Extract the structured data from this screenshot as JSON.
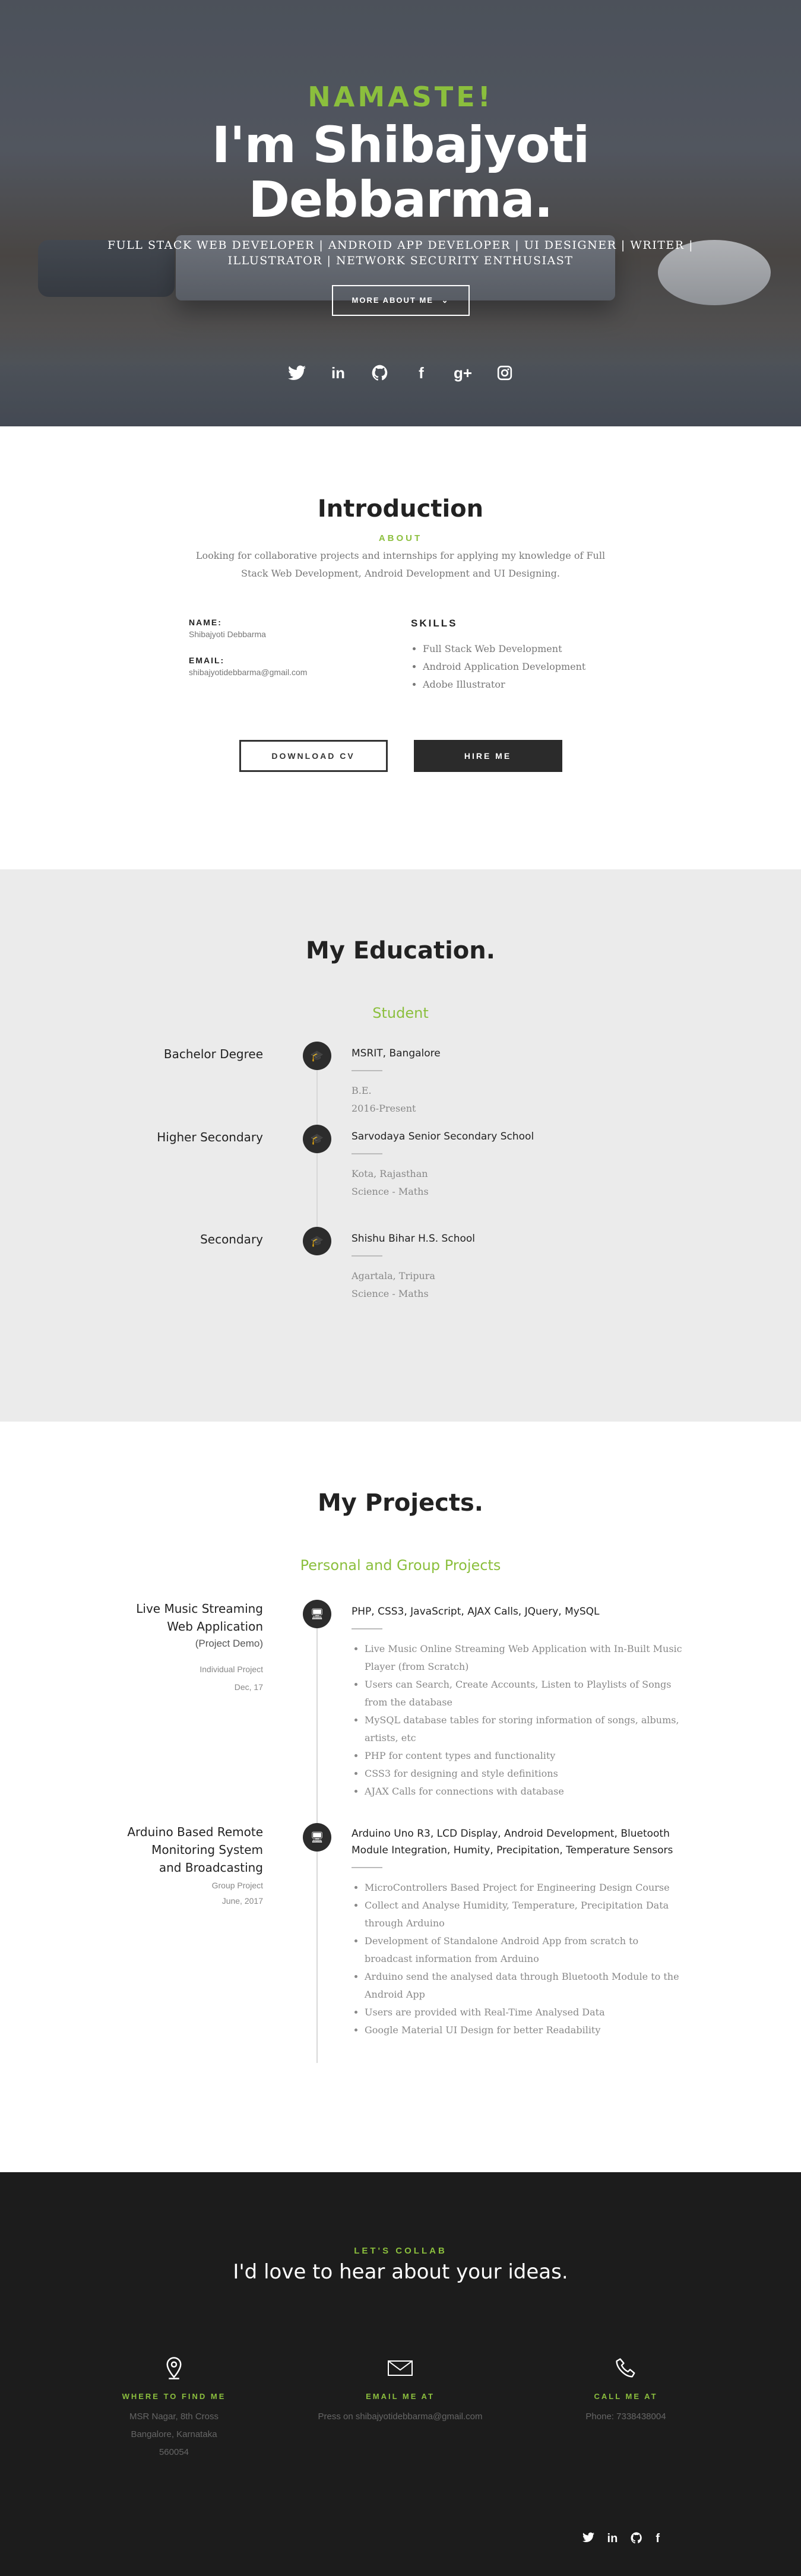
{
  "hero": {
    "greeting": "NAMASTE!",
    "name_line1": "I'm Shibajyoti",
    "name_line2": "Debbarma.",
    "tagline": "FULL STACK WEB DEVELOPER | ANDROID APP DEVELOPER | UI DESIGNER | WRITER | ILLUSTRATOR | NETWORK SECURITY ENTHUSIAST",
    "more_button": "MORE ABOUT ME",
    "social": [
      "twitter-icon",
      "linkedin-icon",
      "github-icon",
      "facebook-icon",
      "google-plus-icon",
      "instagram-icon"
    ]
  },
  "intro": {
    "title": "Introduction",
    "subtitle": "ABOUT",
    "text": "Looking for collaborative projects and internships for applying my knowledge of Full Stack Web Development, Android Development and UI Designing.",
    "name_label": "NAME:",
    "name_value": "Shibajyoti Debbarma",
    "email_label": "EMAIL:",
    "email_value": "shibajyotidebbarma@gmail.com",
    "skills_title": "SKILLS",
    "skills": [
      "Full Stack Web Development",
      "Android Application Development",
      "Adobe Illustrator"
    ],
    "download_button": "DOWNLOAD CV",
    "hire_button": "HIRE ME"
  },
  "education": {
    "title": "My Education.",
    "subtitle": "Student",
    "items": [
      {
        "level": "Bachelor Degree",
        "school": "MSRIT, Bangalore",
        "line1": "B.E.",
        "line2": "2016-Present"
      },
      {
        "level": "Higher Secondary",
        "school": "Sarvodaya Senior Secondary School",
        "line1": "Kota, Rajasthan",
        "line2": "Science - Maths"
      },
      {
        "level": "Secondary",
        "school": "Shishu Bihar H.S. School",
        "line1": "Agartala, Tripura",
        "line2": "Science - Maths"
      }
    ]
  },
  "projects": {
    "title": "My Projects.",
    "subtitle": "Personal and Group Projects",
    "items": [
      {
        "title_line1": "Live Music Streaming",
        "title_line2": "Web Application",
        "note": "(Project Demo)",
        "type": "Individual Project",
        "date": "Dec, 17",
        "tech": "PHP, CSS3, JavaScript, AJAX Calls, JQuery, MySQL",
        "points": [
          "Live Music Online Streaming Web Application with In-Built Music Player (from Scratch)",
          "Users can Search, Create Accounts, Listen to Playlists of Songs from the database",
          "MySQL database tables for storing information of songs, albums, artists, etc",
          "PHP for content types and functionality",
          "CSS3 for designing and style definitions",
          "AJAX Calls for connections with database"
        ]
      },
      {
        "title_line1": "Arduino Based Remote",
        "title_line2": "Monitoring System",
        "title_line3": "and Broadcasting",
        "type": "Group Project",
        "date": "June, 2017",
        "tech": "Arduino Uno R3, LCD Display, Android Development, Bluetooth Module Integration, Humity, Precipitation, Temperature Sensors",
        "points": [
          "MicroControllers Based Project for Engineering Design Course",
          "Collect and Analyse Humidity, Temperature, Precipitation Data through Arduino",
          "Development of Standalone Android App from scratch to broadcast information from Arduino",
          "Arduino send the analysed data through Bluetooth Module to the Android App",
          "Users are provided with Real-Time Analysed Data",
          "Google Material UI Design for better Readability"
        ]
      }
    ]
  },
  "footer": {
    "collab_sub": "LET'S COLLAB",
    "collab_title": "I'd love to hear about your ideas.",
    "find_label": "WHERE TO FIND ME",
    "find_line1": "MSR Nagar, 8th Cross",
    "find_line2": "Bangalore, Karnataka",
    "find_line3": "560054",
    "email_label": "EMAIL ME AT",
    "email_value": "Press on shibajyotidebbarma@gmail.com",
    "call_label": "CALL ME AT",
    "call_value": "Phone: 7338438004",
    "social": [
      "twitter-icon",
      "linkedin-icon",
      "github-icon",
      "facebook-icon"
    ]
  },
  "colors": {
    "accent": "#8bbf3d",
    "dark": "#2b2b2b",
    "footer_bg": "#1c1c1c",
    "edu_bg": "#ebebeb"
  }
}
